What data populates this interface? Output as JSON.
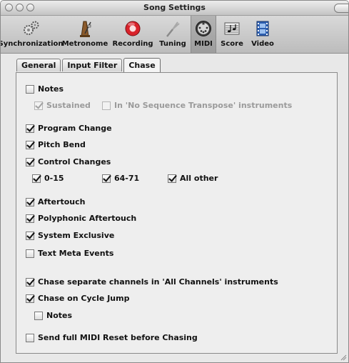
{
  "window": {
    "title": "Song Settings"
  },
  "toolbar": {
    "items": [
      {
        "label": "Synchronization",
        "icon": "synchronization-gears-icon"
      },
      {
        "label": "Metronome",
        "icon": "metronome-icon"
      },
      {
        "label": "Recording",
        "icon": "record-icon"
      },
      {
        "label": "Tuning",
        "icon": "tuning-fork-icon"
      },
      {
        "label": "MIDI",
        "icon": "midi-connector-icon",
        "selected": true
      },
      {
        "label": "Score",
        "icon": "score-notes-icon"
      },
      {
        "label": "Video",
        "icon": "video-film-icon"
      }
    ]
  },
  "tabs": {
    "general": "General",
    "input_filter": "Input Filter",
    "chase": "Chase",
    "active": "Chase"
  },
  "chase": {
    "notes": {
      "label": "Notes",
      "checked": false
    },
    "sustained": {
      "label": "Sustained",
      "checked": true,
      "disabled": true
    },
    "no_seq_transpose": {
      "label": "In 'No Sequence Transpose' instruments",
      "checked": false,
      "disabled": true
    },
    "program_change": {
      "label": "Program Change",
      "checked": true
    },
    "pitch_bend": {
      "label": "Pitch Bend",
      "checked": true
    },
    "control_changes": {
      "label": "Control Changes",
      "checked": true
    },
    "cc_0_15": {
      "label": "0-15",
      "checked": true
    },
    "cc_64_71": {
      "label": "64-71",
      "checked": true
    },
    "cc_all_other": {
      "label": "All other",
      "checked": true
    },
    "aftertouch": {
      "label": "Aftertouch",
      "checked": true
    },
    "poly_aftertouch": {
      "label": "Polyphonic Aftertouch",
      "checked": true
    },
    "sysex": {
      "label": "System Exclusive",
      "checked": true
    },
    "text_meta": {
      "label": "Text Meta Events",
      "checked": false
    },
    "separate_channels": {
      "label": "Chase separate channels in 'All Channels' instruments",
      "checked": true
    },
    "cycle_jump": {
      "label": "Chase on Cycle Jump",
      "checked": true
    },
    "cycle_notes": {
      "label": "Notes",
      "checked": false
    },
    "midi_reset": {
      "label": "Send full MIDI Reset before Chasing",
      "checked": false
    }
  }
}
